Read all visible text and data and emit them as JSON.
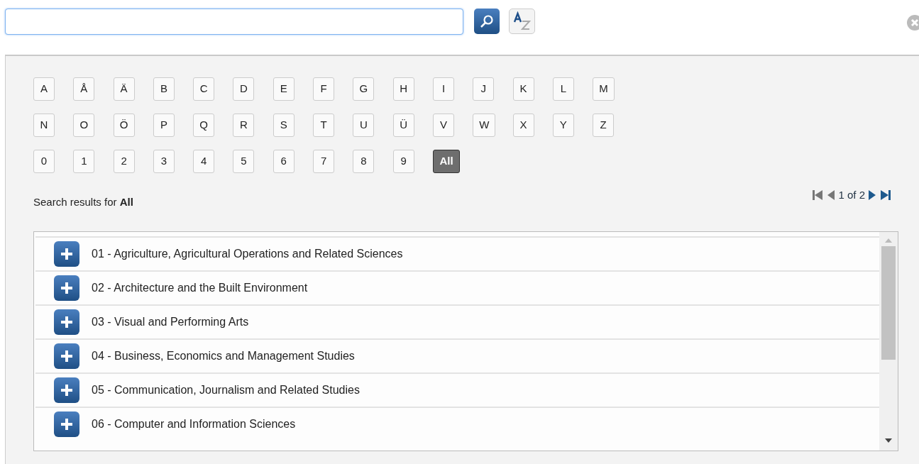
{
  "letter_rows": [
    [
      {
        "label": "A",
        "selected": false
      },
      {
        "label": "Å",
        "selected": false
      },
      {
        "label": "Ä",
        "selected": false
      },
      {
        "label": "B",
        "selected": false
      },
      {
        "label": "C",
        "selected": false
      },
      {
        "label": "D",
        "selected": false
      },
      {
        "label": "E",
        "selected": false
      },
      {
        "label": "F",
        "selected": false
      },
      {
        "label": "G",
        "selected": false
      },
      {
        "label": "H",
        "selected": false
      },
      {
        "label": "I",
        "selected": false
      },
      {
        "label": "J",
        "selected": false
      },
      {
        "label": "K",
        "selected": false
      },
      {
        "label": "L",
        "selected": false
      },
      {
        "label": "M",
        "selected": false
      }
    ],
    [
      {
        "label": "N",
        "selected": false
      },
      {
        "label": "O",
        "selected": false
      },
      {
        "label": "Ö",
        "selected": false
      },
      {
        "label": "P",
        "selected": false
      },
      {
        "label": "Q",
        "selected": false
      },
      {
        "label": "R",
        "selected": false
      },
      {
        "label": "S",
        "selected": false
      },
      {
        "label": "T",
        "selected": false
      },
      {
        "label": "U",
        "selected": false
      },
      {
        "label": "Ü",
        "selected": false
      },
      {
        "label": "V",
        "selected": false
      },
      {
        "label": "W",
        "selected": false
      },
      {
        "label": "X",
        "selected": false
      },
      {
        "label": "Y",
        "selected": false
      },
      {
        "label": "Z",
        "selected": false
      }
    ],
    [
      {
        "label": "0",
        "selected": false
      },
      {
        "label": "1",
        "selected": false
      },
      {
        "label": "2",
        "selected": false
      },
      {
        "label": "3",
        "selected": false
      },
      {
        "label": "4",
        "selected": false
      },
      {
        "label": "5",
        "selected": false
      },
      {
        "label": "6",
        "selected": false
      },
      {
        "label": "7",
        "selected": false
      },
      {
        "label": "8",
        "selected": false
      },
      {
        "label": "9",
        "selected": false
      },
      {
        "label": "All",
        "selected": true
      }
    ]
  ],
  "results_caption": "Search results for **All**",
  "pager": {
    "page": "1 of 2"
  },
  "results": [
    {
      "label": "01 - Agriculture, Agricultural Operations and Related Sciences",
      "expanded": false
    },
    {
      "label": "02 - Architecture and the Built Environment",
      "expanded": false
    },
    {
      "label": "03 - Visual and Performing Arts",
      "expanded": false
    },
    {
      "label": "04 - Business, Economics and Management Studies",
      "expanded": false
    },
    {
      "label": "05 - Communication, Journalism and Related Studies",
      "expanded": false
    },
    {
      "label": "06 - Computer and Information Sciences",
      "expanded": false
    }
  ]
}
